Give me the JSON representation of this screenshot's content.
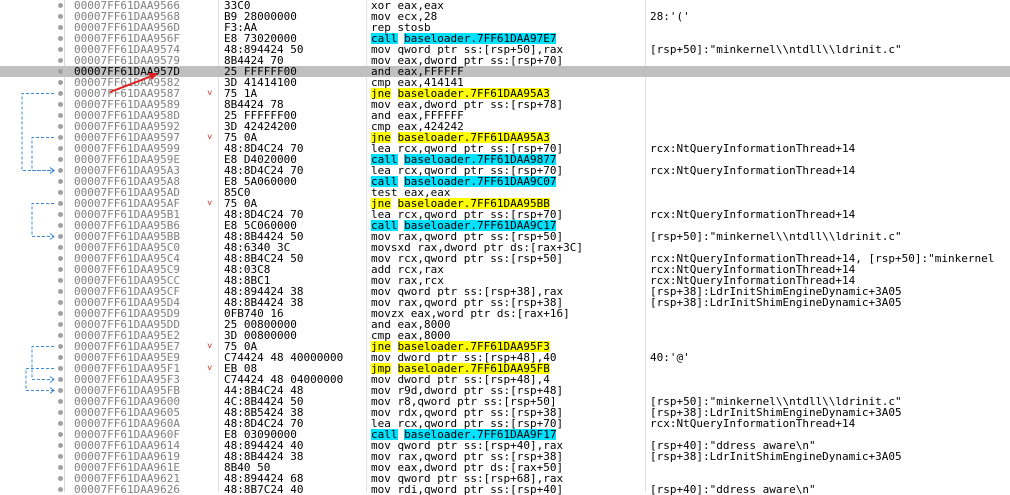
{
  "rows": [
    {
      "addr": "00007FF61DAA9566",
      "bytes": "33C0",
      "mn": "xor",
      "ops": [
        {
          "t": "eax,eax"
        }
      ],
      "cmt": ""
    },
    {
      "addr": "00007FF61DAA9568",
      "bytes": "B9 28000000",
      "mn": "mov",
      "ops": [
        {
          "t": "ecx,28"
        }
      ],
      "cmt": "28:'('"
    },
    {
      "addr": "00007FF61DAA956D",
      "bytes": "F3:AA",
      "mn": "rep stosb",
      "ops": [],
      "cmt": ""
    },
    {
      "addr": "00007FF61DAA956F",
      "bytes": "E8 73020000",
      "mn": "call",
      "ops": [
        {
          "t": "baseloader.7FF61DAA97E7"
        }
      ],
      "cmt": "",
      "hl": "call"
    },
    {
      "addr": "00007FF61DAA9574",
      "bytes": "48:894424 50",
      "mn": "mov",
      "ops": [
        {
          "t": "qword ptr ss:[rsp+50],rax"
        }
      ],
      "cmt": "[rsp+50]:\"minkernel\\\\ntdll\\\\ldrinit.c\""
    },
    {
      "addr": "00007FF61DAA9579",
      "bytes": "8B4424 70",
      "mn": "mov",
      "ops": [
        {
          "t": "eax,dword ptr ss:[rsp+70]"
        }
      ],
      "cmt": ""
    },
    {
      "addr": "00007FF61DAA957D",
      "bytes": "25 FFFFFF00",
      "mn": "and",
      "ops": [
        {
          "t": "eax,FFFFFF"
        }
      ],
      "cmt": "",
      "sel": true
    },
    {
      "addr": "00007FF61DAA9582",
      "bytes": "3D 41414100",
      "mn": "cmp",
      "ops": [
        {
          "t": "eax,414141"
        }
      ],
      "cmt": ""
    },
    {
      "addr": "00007FF61DAA9587",
      "bytes": "75 1A",
      "mn": "jne",
      "ops": [
        {
          "t": "baseloader.7FF61DAA95A3"
        }
      ],
      "cmt": "",
      "hl": "jmp",
      "ja": true
    },
    {
      "addr": "00007FF61DAA9589",
      "bytes": "8B4424 78",
      "mn": "mov",
      "ops": [
        {
          "t": "eax,dword ptr ss:[rsp+78]"
        }
      ],
      "cmt": ""
    },
    {
      "addr": "00007FF61DAA958D",
      "bytes": "25 FFFFFF00",
      "mn": "and",
      "ops": [
        {
          "t": "eax,FFFFFF"
        }
      ],
      "cmt": ""
    },
    {
      "addr": "00007FF61DAA9592",
      "bytes": "3D 42424200",
      "mn": "cmp",
      "ops": [
        {
          "t": "eax,424242"
        }
      ],
      "cmt": ""
    },
    {
      "addr": "00007FF61DAA9597",
      "bytes": "75 0A",
      "mn": "jne",
      "ops": [
        {
          "t": "baseloader.7FF61DAA95A3"
        }
      ],
      "cmt": "",
      "hl": "jmp",
      "ja": true
    },
    {
      "addr": "00007FF61DAA9599",
      "bytes": "48:8D4C24 70",
      "mn": "lea",
      "ops": [
        {
          "t": "rcx,qword ptr ss:[rsp+70]"
        }
      ],
      "cmt": "rcx:NtQueryInformationThread+14"
    },
    {
      "addr": "00007FF61DAA959E",
      "bytes": "E8 D4020000",
      "mn": "call",
      "ops": [
        {
          "t": "baseloader.7FF61DAA9877"
        }
      ],
      "cmt": "",
      "hl": "call"
    },
    {
      "addr": "00007FF61DAA95A3",
      "bytes": "48:8D4C24 70",
      "mn": "lea",
      "ops": [
        {
          "t": "rcx,qword ptr ss:[rsp+70]"
        }
      ],
      "cmt": "rcx:NtQueryInformationThread+14"
    },
    {
      "addr": "00007FF61DAA95A8",
      "bytes": "E8 5A060000",
      "mn": "call",
      "ops": [
        {
          "t": "baseloader.7FF61DAA9C07"
        }
      ],
      "cmt": "",
      "hl": "call"
    },
    {
      "addr": "00007FF61DAA95AD",
      "bytes": "85C0",
      "mn": "test",
      "ops": [
        {
          "t": "eax,eax"
        }
      ],
      "cmt": ""
    },
    {
      "addr": "00007FF61DAA95AF",
      "bytes": "75 0A",
      "mn": "jne",
      "ops": [
        {
          "t": "baseloader.7FF61DAA95BB"
        }
      ],
      "cmt": "",
      "hl": "jmp",
      "ja": true
    },
    {
      "addr": "00007FF61DAA95B1",
      "bytes": "48:8D4C24 70",
      "mn": "lea",
      "ops": [
        {
          "t": "rcx,qword ptr ss:[rsp+70]"
        }
      ],
      "cmt": "rcx:NtQueryInformationThread+14"
    },
    {
      "addr": "00007FF61DAA95B6",
      "bytes": "E8 5C060000",
      "mn": "call",
      "ops": [
        {
          "t": "baseloader.7FF61DAA9C17"
        }
      ],
      "cmt": "",
      "hl": "call"
    },
    {
      "addr": "00007FF61DAA95BB",
      "bytes": "48:8B4424 50",
      "mn": "mov",
      "ops": [
        {
          "t": "rax,qword ptr ss:[rsp+50]"
        }
      ],
      "cmt": "[rsp+50]:\"minkernel\\\\ntdll\\\\ldrinit.c\""
    },
    {
      "addr": "00007FF61DAA95C0",
      "bytes": "48:6340 3C",
      "mn": "movsxd",
      "ops": [
        {
          "t": "rax,dword ptr ds:[rax+3C]"
        }
      ],
      "cmt": ""
    },
    {
      "addr": "00007FF61DAA95C4",
      "bytes": "48:8B4C24 50",
      "mn": "mov",
      "ops": [
        {
          "t": "rcx,qword ptr ss:[rsp+50]"
        }
      ],
      "cmt": "rcx:NtQueryInformationThread+14, [rsp+50]:\"minkernel"
    },
    {
      "addr": "00007FF61DAA95C9",
      "bytes": "48:03C8",
      "mn": "add",
      "ops": [
        {
          "t": "rcx,rax"
        }
      ],
      "cmt": "rcx:NtQueryInformationThread+14"
    },
    {
      "addr": "00007FF61DAA95CC",
      "bytes": "48:8BC1",
      "mn": "mov",
      "ops": [
        {
          "t": "rax,rcx"
        }
      ],
      "cmt": "rcx:NtQueryInformationThread+14"
    },
    {
      "addr": "00007FF61DAA95CF",
      "bytes": "48:894424 38",
      "mn": "mov",
      "ops": [
        {
          "t": "qword ptr ss:[rsp+38],rax"
        }
      ],
      "cmt": "[rsp+38]:LdrInitShimEngineDynamic+3A05"
    },
    {
      "addr": "00007FF61DAA95D4",
      "bytes": "48:8B4424 38",
      "mn": "mov",
      "ops": [
        {
          "t": "rax,qword ptr ss:[rsp+38]"
        }
      ],
      "cmt": "[rsp+38]:LdrInitShimEngineDynamic+3A05"
    },
    {
      "addr": "00007FF61DAA95D9",
      "bytes": "0FB740 16",
      "mn": "movzx",
      "ops": [
        {
          "t": "eax,word ptr ds:[rax+16]"
        }
      ],
      "cmt": ""
    },
    {
      "addr": "00007FF61DAA95DD",
      "bytes": "25 00800000",
      "mn": "and",
      "ops": [
        {
          "t": "eax,8000"
        }
      ],
      "cmt": ""
    },
    {
      "addr": "00007FF61DAA95E2",
      "bytes": "3D 00800000",
      "mn": "cmp",
      "ops": [
        {
          "t": "eax,8000"
        }
      ],
      "cmt": ""
    },
    {
      "addr": "00007FF61DAA95E7",
      "bytes": "75 0A",
      "mn": "jne",
      "ops": [
        {
          "t": "baseloader.7FF61DAA95F3"
        }
      ],
      "cmt": "",
      "hl": "jmp",
      "ja": true
    },
    {
      "addr": "00007FF61DAA95E9",
      "bytes": "C74424 48 40000000",
      "mn": "mov",
      "ops": [
        {
          "t": "dword ptr ss:[rsp+48],40"
        }
      ],
      "cmt": "40:'@'"
    },
    {
      "addr": "00007FF61DAA95F1",
      "bytes": "EB 08",
      "mn": "jmp",
      "ops": [
        {
          "t": "baseloader.7FF61DAA95FB"
        }
      ],
      "cmt": "",
      "hl": "jmp",
      "ja": true
    },
    {
      "addr": "00007FF61DAA95F3",
      "bytes": "C74424 48 04000000",
      "mn": "mov",
      "ops": [
        {
          "t": "dword ptr ss:[rsp+48],4"
        }
      ],
      "cmt": ""
    },
    {
      "addr": "00007FF61DAA95FB",
      "bytes": "44:8B4C24 48",
      "mn": "mov",
      "ops": [
        {
          "t": "r9d,dword ptr ss:[rsp+48]"
        }
      ],
      "cmt": ""
    },
    {
      "addr": "00007FF61DAA9600",
      "bytes": "4C:8B4424 50",
      "mn": "mov",
      "ops": [
        {
          "t": "r8,qword ptr ss:[rsp+50]"
        }
      ],
      "cmt": "[rsp+50]:\"minkernel\\\\ntdll\\\\ldrinit.c\""
    },
    {
      "addr": "00007FF61DAA9605",
      "bytes": "48:8B5424 38",
      "mn": "mov",
      "ops": [
        {
          "t": "rdx,qword ptr ss:[rsp+38]"
        }
      ],
      "cmt": "[rsp+38]:LdrInitShimEngineDynamic+3A05"
    },
    {
      "addr": "00007FF61DAA960A",
      "bytes": "48:8D4C24 70",
      "mn": "lea",
      "ops": [
        {
          "t": "rcx,qword ptr ss:[rsp+70]"
        }
      ],
      "cmt": "rcx:NtQueryInformationThread+14"
    },
    {
      "addr": "00007FF61DAA960F",
      "bytes": "E8 03090000",
      "mn": "call",
      "ops": [
        {
          "t": "baseloader.7FF61DAA9F17"
        }
      ],
      "cmt": "",
      "hl": "call"
    },
    {
      "addr": "00007FF61DAA9614",
      "bytes": "48:894424 40",
      "mn": "mov",
      "ops": [
        {
          "t": "qword ptr ss:[rsp+40],rax"
        }
      ],
      "cmt": "[rsp+40]:\"ddress aware\\n\""
    },
    {
      "addr": "00007FF61DAA9619",
      "bytes": "48:8B4424 38",
      "mn": "mov",
      "ops": [
        {
          "t": "rax,qword ptr ss:[rsp+38]"
        }
      ],
      "cmt": "[rsp+38]:LdrInitShimEngineDynamic+3A05"
    },
    {
      "addr": "00007FF61DAA961E",
      "bytes": "8B40 50",
      "mn": "mov",
      "ops": [
        {
          "t": "eax,dword ptr ds:[rax+50]"
        }
      ],
      "cmt": ""
    },
    {
      "addr": "00007FF61DAA9621",
      "bytes": "48:894424 68",
      "mn": "mov",
      "ops": [
        {
          "t": "qword ptr ss:[rsp+68],rax"
        }
      ],
      "cmt": ""
    },
    {
      "addr": "00007FF61DAA9626",
      "bytes": "48:8B7C24 40",
      "mn": "mov",
      "ops": [
        {
          "t": "rdi,qword ptr ss:[rsp+40]"
        }
      ],
      "cmt": "[rsp+40]:\"ddress aware\\n\""
    }
  ],
  "colors": {
    "call_highlight": "#00e0ff",
    "jump_highlight": "#ffff00",
    "selected_row": "#c0c0c0",
    "address": "#808080",
    "jump_arrow": "#d02020",
    "branch_lines": "#3a8ad8"
  }
}
